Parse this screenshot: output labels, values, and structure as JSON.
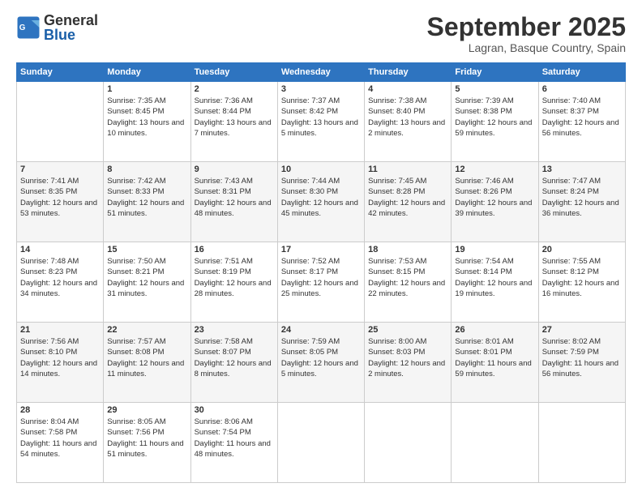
{
  "header": {
    "logo_line1": "General",
    "logo_line2": "Blue",
    "month_title": "September 2025",
    "location": "Lagran, Basque Country, Spain"
  },
  "days_of_week": [
    "Sunday",
    "Monday",
    "Tuesday",
    "Wednesday",
    "Thursday",
    "Friday",
    "Saturday"
  ],
  "weeks": [
    [
      {
        "day": "",
        "sunrise": "",
        "sunset": "",
        "daylight": ""
      },
      {
        "day": "1",
        "sunrise": "Sunrise: 7:35 AM",
        "sunset": "Sunset: 8:45 PM",
        "daylight": "Daylight: 13 hours and 10 minutes."
      },
      {
        "day": "2",
        "sunrise": "Sunrise: 7:36 AM",
        "sunset": "Sunset: 8:44 PM",
        "daylight": "Daylight: 13 hours and 7 minutes."
      },
      {
        "day": "3",
        "sunrise": "Sunrise: 7:37 AM",
        "sunset": "Sunset: 8:42 PM",
        "daylight": "Daylight: 13 hours and 5 minutes."
      },
      {
        "day": "4",
        "sunrise": "Sunrise: 7:38 AM",
        "sunset": "Sunset: 8:40 PM",
        "daylight": "Daylight: 13 hours and 2 minutes."
      },
      {
        "day": "5",
        "sunrise": "Sunrise: 7:39 AM",
        "sunset": "Sunset: 8:38 PM",
        "daylight": "Daylight: 12 hours and 59 minutes."
      },
      {
        "day": "6",
        "sunrise": "Sunrise: 7:40 AM",
        "sunset": "Sunset: 8:37 PM",
        "daylight": "Daylight: 12 hours and 56 minutes."
      }
    ],
    [
      {
        "day": "7",
        "sunrise": "Sunrise: 7:41 AM",
        "sunset": "Sunset: 8:35 PM",
        "daylight": "Daylight: 12 hours and 53 minutes."
      },
      {
        "day": "8",
        "sunrise": "Sunrise: 7:42 AM",
        "sunset": "Sunset: 8:33 PM",
        "daylight": "Daylight: 12 hours and 51 minutes."
      },
      {
        "day": "9",
        "sunrise": "Sunrise: 7:43 AM",
        "sunset": "Sunset: 8:31 PM",
        "daylight": "Daylight: 12 hours and 48 minutes."
      },
      {
        "day": "10",
        "sunrise": "Sunrise: 7:44 AM",
        "sunset": "Sunset: 8:30 PM",
        "daylight": "Daylight: 12 hours and 45 minutes."
      },
      {
        "day": "11",
        "sunrise": "Sunrise: 7:45 AM",
        "sunset": "Sunset: 8:28 PM",
        "daylight": "Daylight: 12 hours and 42 minutes."
      },
      {
        "day": "12",
        "sunrise": "Sunrise: 7:46 AM",
        "sunset": "Sunset: 8:26 PM",
        "daylight": "Daylight: 12 hours and 39 minutes."
      },
      {
        "day": "13",
        "sunrise": "Sunrise: 7:47 AM",
        "sunset": "Sunset: 8:24 PM",
        "daylight": "Daylight: 12 hours and 36 minutes."
      }
    ],
    [
      {
        "day": "14",
        "sunrise": "Sunrise: 7:48 AM",
        "sunset": "Sunset: 8:23 PM",
        "daylight": "Daylight: 12 hours and 34 minutes."
      },
      {
        "day": "15",
        "sunrise": "Sunrise: 7:50 AM",
        "sunset": "Sunset: 8:21 PM",
        "daylight": "Daylight: 12 hours and 31 minutes."
      },
      {
        "day": "16",
        "sunrise": "Sunrise: 7:51 AM",
        "sunset": "Sunset: 8:19 PM",
        "daylight": "Daylight: 12 hours and 28 minutes."
      },
      {
        "day": "17",
        "sunrise": "Sunrise: 7:52 AM",
        "sunset": "Sunset: 8:17 PM",
        "daylight": "Daylight: 12 hours and 25 minutes."
      },
      {
        "day": "18",
        "sunrise": "Sunrise: 7:53 AM",
        "sunset": "Sunset: 8:15 PM",
        "daylight": "Daylight: 12 hours and 22 minutes."
      },
      {
        "day": "19",
        "sunrise": "Sunrise: 7:54 AM",
        "sunset": "Sunset: 8:14 PM",
        "daylight": "Daylight: 12 hours and 19 minutes."
      },
      {
        "day": "20",
        "sunrise": "Sunrise: 7:55 AM",
        "sunset": "Sunset: 8:12 PM",
        "daylight": "Daylight: 12 hours and 16 minutes."
      }
    ],
    [
      {
        "day": "21",
        "sunrise": "Sunrise: 7:56 AM",
        "sunset": "Sunset: 8:10 PM",
        "daylight": "Daylight: 12 hours and 14 minutes."
      },
      {
        "day": "22",
        "sunrise": "Sunrise: 7:57 AM",
        "sunset": "Sunset: 8:08 PM",
        "daylight": "Daylight: 12 hours and 11 minutes."
      },
      {
        "day": "23",
        "sunrise": "Sunrise: 7:58 AM",
        "sunset": "Sunset: 8:07 PM",
        "daylight": "Daylight: 12 hours and 8 minutes."
      },
      {
        "day": "24",
        "sunrise": "Sunrise: 7:59 AM",
        "sunset": "Sunset: 8:05 PM",
        "daylight": "Daylight: 12 hours and 5 minutes."
      },
      {
        "day": "25",
        "sunrise": "Sunrise: 8:00 AM",
        "sunset": "Sunset: 8:03 PM",
        "daylight": "Daylight: 12 hours and 2 minutes."
      },
      {
        "day": "26",
        "sunrise": "Sunrise: 8:01 AM",
        "sunset": "Sunset: 8:01 PM",
        "daylight": "Daylight: 11 hours and 59 minutes."
      },
      {
        "day": "27",
        "sunrise": "Sunrise: 8:02 AM",
        "sunset": "Sunset: 7:59 PM",
        "daylight": "Daylight: 11 hours and 56 minutes."
      }
    ],
    [
      {
        "day": "28",
        "sunrise": "Sunrise: 8:04 AM",
        "sunset": "Sunset: 7:58 PM",
        "daylight": "Daylight: 11 hours and 54 minutes."
      },
      {
        "day": "29",
        "sunrise": "Sunrise: 8:05 AM",
        "sunset": "Sunset: 7:56 PM",
        "daylight": "Daylight: 11 hours and 51 minutes."
      },
      {
        "day": "30",
        "sunrise": "Sunrise: 8:06 AM",
        "sunset": "Sunset: 7:54 PM",
        "daylight": "Daylight: 11 hours and 48 minutes."
      },
      {
        "day": "",
        "sunrise": "",
        "sunset": "",
        "daylight": ""
      },
      {
        "day": "",
        "sunrise": "",
        "sunset": "",
        "daylight": ""
      },
      {
        "day": "",
        "sunrise": "",
        "sunset": "",
        "daylight": ""
      },
      {
        "day": "",
        "sunrise": "",
        "sunset": "",
        "daylight": ""
      }
    ]
  ]
}
